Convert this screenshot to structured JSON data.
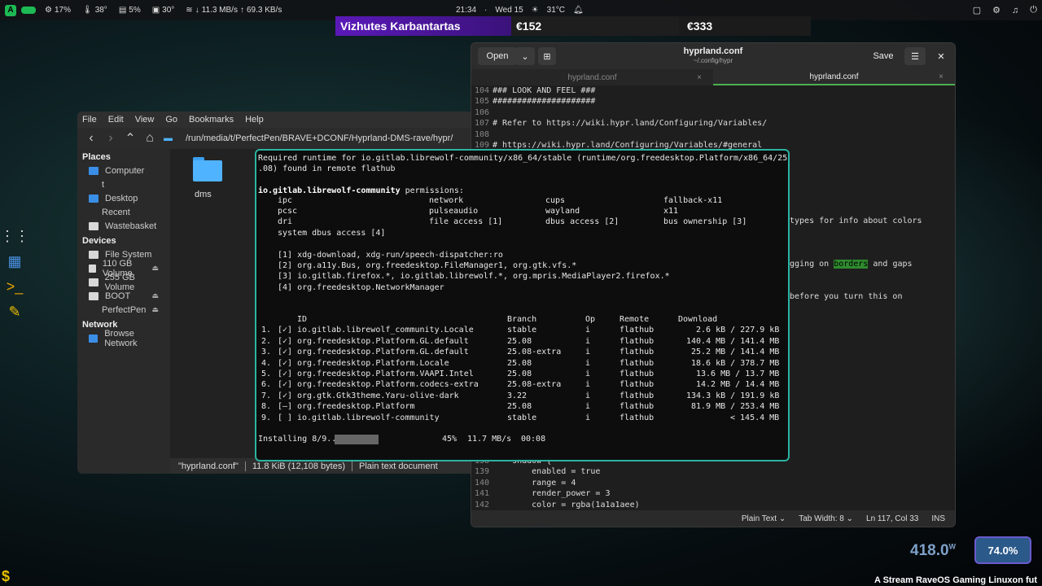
{
  "topbar": {
    "cpu": "17%",
    "temp1": "38°",
    "mem": "5%",
    "temp2": "30°",
    "net": "11.3 MB/s",
    "net_up": "69.3 KB/s",
    "time": "21:34",
    "date": "Wed 15",
    "weather": "31°C"
  },
  "banner": {
    "name": "Vizhutes Karbantartas",
    "price1": "€152",
    "price2": "€333"
  },
  "dock": {
    "icons": [
      "apps-grid-icon",
      "flatpak-icon",
      "terminal-icon",
      "text-editor-icon"
    ]
  },
  "filemanager": {
    "menu": [
      "File",
      "Edit",
      "View",
      "Go",
      "Bookmarks",
      "Help"
    ],
    "path": "/run/media/t/PerfectPen/BRAVE+DCONF/Hyprland-DMS-rave/hypr/",
    "places_header": "Places",
    "places": [
      "Computer",
      "t",
      "Desktop",
      "Recent",
      "Wastebasket"
    ],
    "devices_header": "Devices",
    "devices": [
      "File System",
      "110 GB Volume",
      "255 GB Volume",
      "BOOT",
      "PerfectPen"
    ],
    "network_header": "Network",
    "network": [
      "Browse Network"
    ],
    "folder": "dms",
    "status": {
      "file": "\"hyprland.conf\"",
      "size": "11.8 KiB (12,108 bytes)",
      "type": "Plain text document"
    }
  },
  "editor": {
    "open_label": "Open",
    "save_label": "Save",
    "title": "hyprland.conf",
    "subtitle": "~/.config/hypr",
    "tabs": [
      "hyprland.conf",
      "hyprland.conf"
    ],
    "lines": [
      {
        "n": "104",
        "t": "### LOOK AND FEEL ###"
      },
      {
        "n": "105",
        "t": "#####################"
      },
      {
        "n": "106",
        "t": ""
      },
      {
        "n": "107",
        "t": "# Refer to https://wiki.hypr.land/Configuring/Variables/"
      },
      {
        "n": "108",
        "t": ""
      },
      {
        "n": "109",
        "t": "# https://wiki.hypr.land/Configuring/Variables/#general"
      }
    ],
    "right_frag_1": "types for info about colors",
    "right_frag_2": "gging on borders and gaps",
    "right_frag_3": "before you turn this on",
    "bottom_lines": [
      {
        "n": "138",
        "t": "    shadow {"
      },
      {
        "n": "139",
        "t": "        enabled = true"
      },
      {
        "n": "140",
        "t": "        range = 4"
      },
      {
        "n": "141",
        "t": "        render_power = 3"
      },
      {
        "n": "142",
        "t": "        color = rgba(1a1a1aee)"
      }
    ],
    "footer": {
      "lang": "Plain Text",
      "tab": "Tab Width: 8",
      "pos": "Ln 117, Col 33",
      "mode": "INS"
    }
  },
  "terminal": {
    "line1": "Required runtime for io.gitlab.librewolf-community/x86_64/stable (runtime/org.freedesktop.Platform/x86_64/25",
    "line2": ".08) found in remote flathub",
    "perm_app": "io.gitlab.librewolf-community",
    "perm_word": " permissions:",
    "perms": [
      [
        "ipc",
        "network",
        "cups",
        "fallback-x11"
      ],
      [
        "pcsc",
        "pulseaudio",
        "wayland",
        "x11"
      ],
      [
        "dri",
        "file access [1]",
        "dbus access [2]",
        "bus ownership [3]"
      ],
      [
        "system dbus access [4]",
        "",
        "",
        ""
      ]
    ],
    "notes": [
      "[1] xdg-download, xdg-run/speech-dispatcher:ro",
      "[2] org.a11y.Bus, org.freedesktop.FileManager1, org.gtk.vfs.*",
      "[3] io.gitlab.firefox.*, io.gitlab.librewolf.*, org.mpris.MediaPlayer2.firefox.*",
      "[4] org.freedesktop.NetworkManager"
    ],
    "headers": {
      "id": "ID",
      "branch": "Branch",
      "op": "Op",
      "remote": "Remote",
      "download": "Download"
    },
    "rows": [
      {
        "num": "1.",
        "chk": "[✓]",
        "id": "io.gitlab.librewolf_community.Locale",
        "branch": "stable",
        "op": "i",
        "remote": "flathub",
        "dl": "2.6 kB / 227.9 kB"
      },
      {
        "num": "2.",
        "chk": "[✓]",
        "id": "org.freedesktop.Platform.GL.default",
        "branch": "25.08",
        "op": "i",
        "remote": "flathub",
        "dl": "140.4 MB / 141.4 MB"
      },
      {
        "num": "3.",
        "chk": "[✓]",
        "id": "org.freedesktop.Platform.GL.default",
        "branch": "25.08-extra",
        "op": "i",
        "remote": "flathub",
        "dl": "25.2 MB / 141.4 MB"
      },
      {
        "num": "4.",
        "chk": "[✓]",
        "id": "org.freedesktop.Platform.Locale",
        "branch": "25.08",
        "op": "i",
        "remote": "flathub",
        "dl": "18.6 kB / 378.7 MB"
      },
      {
        "num": "5.",
        "chk": "[✓]",
        "id": "org.freedesktop.Platform.VAAPI.Intel",
        "branch": "25.08",
        "op": "i",
        "remote": "flathub",
        "dl": "13.6 MB / 13.7 MB"
      },
      {
        "num": "6.",
        "chk": "[✓]",
        "id": "org.freedesktop.Platform.codecs-extra",
        "branch": "25.08-extra",
        "op": "i",
        "remote": "flathub",
        "dl": "14.2 MB / 14.4 MB"
      },
      {
        "num": "7.",
        "chk": "[✓]",
        "id": "org.gtk.Gtk3theme.Yaru-olive-dark",
        "branch": "3.22",
        "op": "i",
        "remote": "flathub",
        "dl": "134.3 kB / 191.9 kB"
      },
      {
        "num": "8.",
        "chk": "[—]",
        "id": "org.freedesktop.Platform",
        "branch": "25.08",
        "op": "i",
        "remote": "flathub",
        "dl": "81.9 MB / 253.4 MB"
      },
      {
        "num": "9.",
        "chk": "[ ]",
        "id": "io.gitlab.librewolf-community",
        "branch": "stable",
        "op": "i",
        "remote": "flathub",
        "dl": "< 145.4 MB"
      }
    ],
    "installing": "Installing 8/9...",
    "progress": "45%",
    "speed": "11.7 MB/s",
    "eta": "00:08"
  },
  "overlay": {
    "watts": "418.0",
    "watt_unit": "W",
    "percent": "74.0%",
    "stream_text": "A Stream RaveOS Gaming Linuxon fut"
  },
  "colors": {
    "accent": "#2bb3a0",
    "green": "#1db954",
    "purple": "#5a19b8"
  }
}
